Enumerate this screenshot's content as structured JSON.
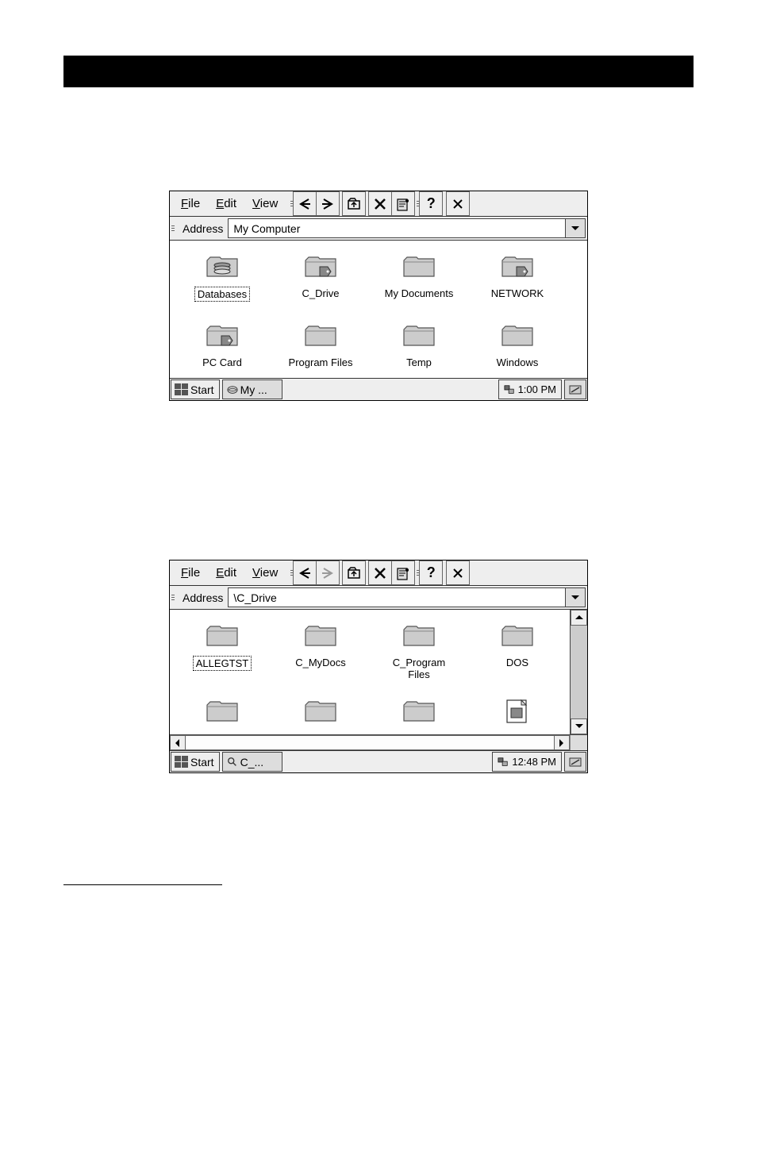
{
  "window1": {
    "menus": {
      "file": "File",
      "edit": "Edit",
      "view": "View"
    },
    "address_label": "Address",
    "address_value": "My Computer",
    "items_row1": [
      {
        "label": "Databases",
        "icon": "stack",
        "selected": true
      },
      {
        "label": "C_Drive",
        "icon": "folder-tag",
        "selected": false
      },
      {
        "label": "My Documents",
        "icon": "folder",
        "selected": false
      },
      {
        "label": "NETWORK",
        "icon": "folder-tag",
        "selected": false
      }
    ],
    "items_row2": [
      {
        "label": "PC Card",
        "icon": "folder-tag",
        "selected": false
      },
      {
        "label": "Program Files",
        "icon": "folder",
        "selected": false
      },
      {
        "label": "Temp",
        "icon": "folder",
        "selected": false
      },
      {
        "label": "Windows",
        "icon": "folder",
        "selected": false
      }
    ],
    "taskbar": {
      "start": "Start",
      "task": "My ...",
      "time": "1:00 PM"
    }
  },
  "window2": {
    "menus": {
      "file": "File",
      "edit": "Edit",
      "view": "View"
    },
    "address_label": "Address",
    "address_value": "\\C_Drive",
    "items_row1": [
      {
        "label": "ALLEGTST",
        "icon": "folder",
        "selected": true
      },
      {
        "label": "C_MyDocs",
        "icon": "folder",
        "selected": false
      },
      {
        "label": "C_Program Files",
        "icon": "folder",
        "selected": false
      },
      {
        "label": "DOS",
        "icon": "folder",
        "selected": false
      }
    ],
    "items_row2": [
      {
        "label": "",
        "icon": "folder",
        "selected": false
      },
      {
        "label": "",
        "icon": "folder",
        "selected": false
      },
      {
        "label": "",
        "icon": "folder",
        "selected": false
      },
      {
        "label": "",
        "icon": "file",
        "selected": false
      }
    ],
    "taskbar": {
      "start": "Start",
      "task": "C_...",
      "time": "12:48 PM"
    }
  }
}
